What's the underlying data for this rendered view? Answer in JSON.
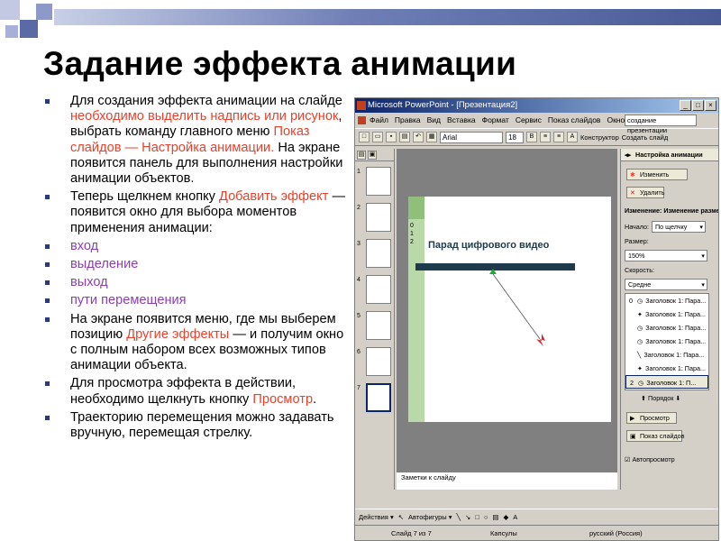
{
  "slide": {
    "title": "Задание эффекта анимации",
    "bullets": [
      {
        "parts": [
          {
            "text": "Для создания эффекта анимации на слайде ",
            "style": ""
          },
          {
            "text": "необходимо выделить надпись или рисунок",
            "style": "hl"
          },
          {
            "text": ", выбрать команду главного меню ",
            "style": ""
          },
          {
            "text": "Показ слайдов — Настройка анимации.",
            "style": "hl"
          },
          {
            "text": " На экране появится панель для выполнения настройки анимации объектов.",
            "style": ""
          }
        ]
      },
      {
        "parts": [
          {
            "text": "Теперь щелкнем кнопку ",
            "style": ""
          },
          {
            "text": "Добавить эффект",
            "style": "hl"
          },
          {
            "text": " — появится окно для выбора моментов применения анимации:",
            "style": ""
          }
        ]
      },
      {
        "parts": [
          {
            "text": "вход",
            "style": "pur"
          }
        ]
      },
      {
        "parts": [
          {
            "text": "выделение",
            "style": "pur"
          }
        ]
      },
      {
        "parts": [
          {
            "text": "выход",
            "style": "pur"
          }
        ]
      },
      {
        "parts": [
          {
            "text": "пути перемещения",
            "style": "pur"
          }
        ]
      },
      {
        "parts": [
          {
            "text": "На экране появится меню, где мы выберем позицию ",
            "style": ""
          },
          {
            "text": "Другие эффекты",
            "style": "hl"
          },
          {
            "text": " — и получим окно с полным набором всех возможных типов анимации объекта.",
            "style": ""
          }
        ]
      },
      {
        "parts": [
          {
            "text": "Для просмотра эффекта в действии, необходимо щелкнуть кнопку ",
            "style": ""
          },
          {
            "text": "Просмотр",
            "style": "hl"
          },
          {
            "text": ".",
            "style": ""
          }
        ]
      },
      {
        "parts": [
          {
            "text": "Траекторию перемещения можно задавать вручную, перемещая стрелку.",
            "style": ""
          }
        ]
      }
    ]
  },
  "window": {
    "title": "Microsoft PowerPoint - [Презентация2]",
    "controls": [
      "_",
      "□",
      "×"
    ],
    "menu": [
      "Файл",
      "Правка",
      "Вид",
      "Вставка",
      "Формат",
      "Сервис",
      "Показ слайдов",
      "Окно",
      "Справка"
    ],
    "help_box": "создание презентации",
    "font": "Arial",
    "font_size": "18",
    "toolbar_designer": "Конструктор",
    "toolbar_new_slide": "Создать слайд",
    "slide_headline": "Парад цифрового видео",
    "slide_order": [
      "0",
      "1",
      "2"
    ],
    "thumb_numbers": [
      "1",
      "2",
      "3",
      "4",
      "5",
      "6",
      "7"
    ],
    "notes": "Заметки к слайду",
    "drawing": [
      "Действия ▾",
      "Автофигуры ▾"
    ],
    "status": {
      "slide": "Слайд 7 из 7",
      "design": "Капсулы",
      "lang": "русский (Россия)"
    }
  },
  "taskpane": {
    "title": "Настройка анимации",
    "change_btn": "Изменить",
    "delete_btn": "Удалить",
    "change_label": "Изменение: Изменение размера",
    "start_label": "Начало:",
    "start_value": "По щелчку",
    "size_label": "Размер:",
    "size_value": "150%",
    "speed_label": "Скорость:",
    "speed_value": "Средне",
    "items": [
      {
        "num": "0",
        "text": "Заголовок 1: Пара..."
      },
      {
        "num": "",
        "text": "Заголовок 1: Пара..."
      },
      {
        "num": "",
        "text": "Заголовок 1: Пара..."
      },
      {
        "num": "",
        "text": "Заголовок 1: Пара..."
      },
      {
        "num": "",
        "text": "Заголовок 1: Пара..."
      },
      {
        "num": "",
        "text": "Заголовок 1: Пара..."
      },
      {
        "num": "2",
        "text": "Заголовок 1: П..."
      }
    ],
    "order_label": "Порядок",
    "preview_btn": "Просмотр",
    "slideshow_btn": "Показ слайдов",
    "autopreview": "Автопросмотр"
  },
  "colors": {
    "accent": "#e8412c",
    "purple": "#8a3fb0",
    "title_bar": "#0a246a"
  }
}
